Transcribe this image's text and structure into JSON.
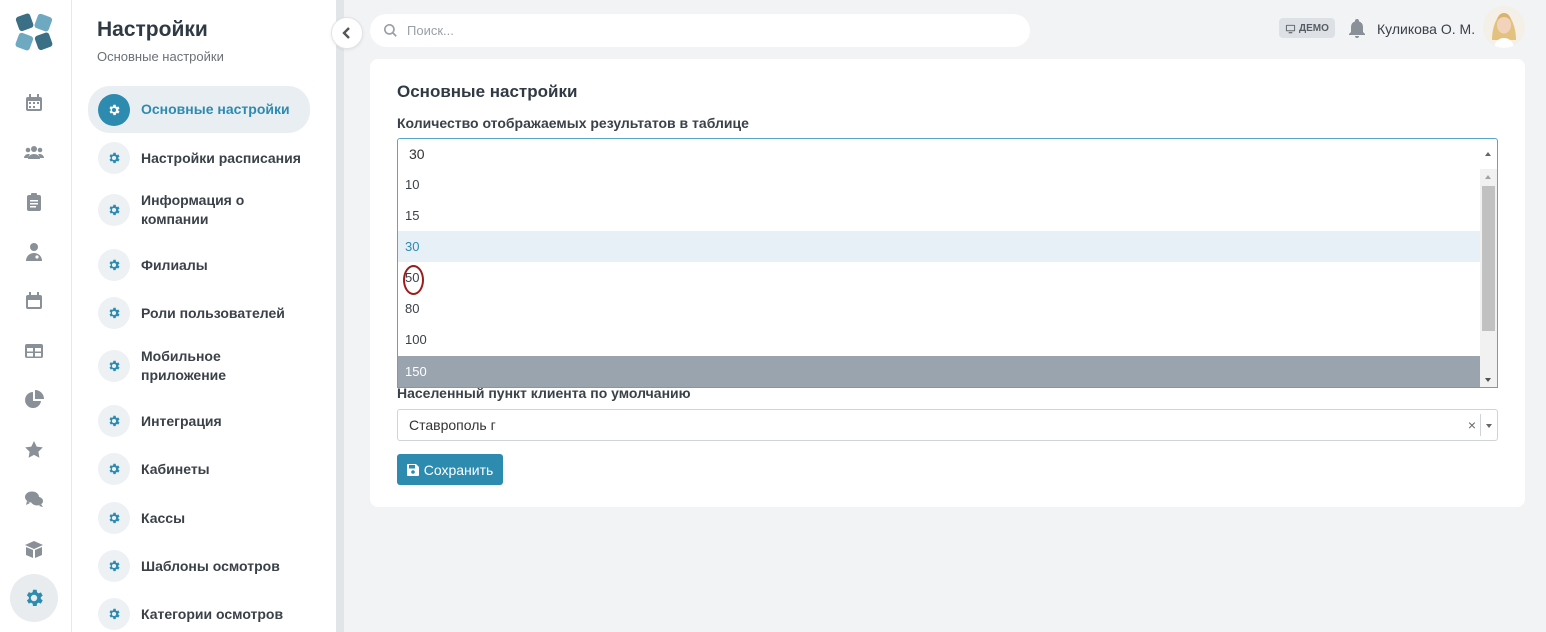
{
  "sidebar": {
    "title": "Настройки",
    "subtitle": "Основные настройки",
    "items": [
      {
        "label": "Основные настройки"
      },
      {
        "label": "Настройки расписания"
      },
      {
        "label": "Информация о компании"
      },
      {
        "label": "Филиалы"
      },
      {
        "label": "Роли пользователей"
      },
      {
        "label": "Мобильное приложение"
      },
      {
        "label": "Интеграция"
      },
      {
        "label": "Кабинеты"
      },
      {
        "label": "Кассы"
      },
      {
        "label": "Шаблоны осмотров"
      },
      {
        "label": "Категории осмотров"
      }
    ]
  },
  "header": {
    "search_placeholder": "Поиск...",
    "demo_badge": "ДЕМО",
    "user_name": "Куликова О. М."
  },
  "main": {
    "title": "Основные настройки",
    "results_label": "Количество отображаемых результатов в таблице",
    "results_value": "30",
    "results_options": [
      "10",
      "15",
      "30",
      "50",
      "80",
      "100",
      "150"
    ],
    "city_label": "Населенный пункт клиента по умолчанию",
    "city_value": "Ставрополь г",
    "clear_symbol": "×",
    "save_label": "Сохранить"
  },
  "colors": {
    "accent": "#2d8bb0",
    "highlight_option": "#9aa4ae",
    "annotation_circle": "#9b1c1c"
  }
}
